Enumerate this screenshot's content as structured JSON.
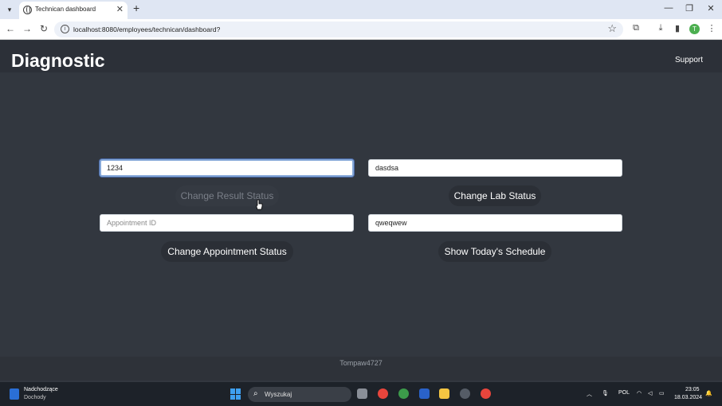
{
  "browser": {
    "tab_title": "Technican dashboard",
    "url": "localhost:8080/employees/technican/dashboard?",
    "icons": [
      "tab-list",
      "close",
      "new-tab",
      "minimize",
      "restore",
      "window-close",
      "back",
      "forward",
      "reload",
      "site-info",
      "bookmark-star",
      "extensions",
      "download",
      "side-panel",
      "profile",
      "menu"
    ],
    "profile_initial": "T"
  },
  "header": {
    "brand": "Diagnostic",
    "support": "Support"
  },
  "form": {
    "result_id": {
      "value": "1234",
      "placeholder": ""
    },
    "lab_id": {
      "value": "dasdsa",
      "placeholder": ""
    },
    "appointment_id": {
      "value": "",
      "placeholder": "Appointment ID"
    },
    "schedule_field": {
      "value": "qweqwew",
      "placeholder": ""
    },
    "change_result_label": "Change Result Status",
    "change_lab_label": "Change Lab Status",
    "change_appointment_label": "Change Appointment Status",
    "show_schedule_label": "Show Today's Schedule"
  },
  "footer": {
    "text": "Tompaw4727"
  },
  "taskbar": {
    "weather_line1": "Nadchodzące",
    "weather_line2": "Dochody",
    "search_placeholder": "Wyszukaj",
    "language": "POL",
    "time": "23:05",
    "date": "18.03.2024"
  },
  "colors": {
    "page_background": "#32373f",
    "header_background": "#2c3038",
    "button_background": "#2b2f36",
    "focus_ring": "#86a8d8"
  }
}
